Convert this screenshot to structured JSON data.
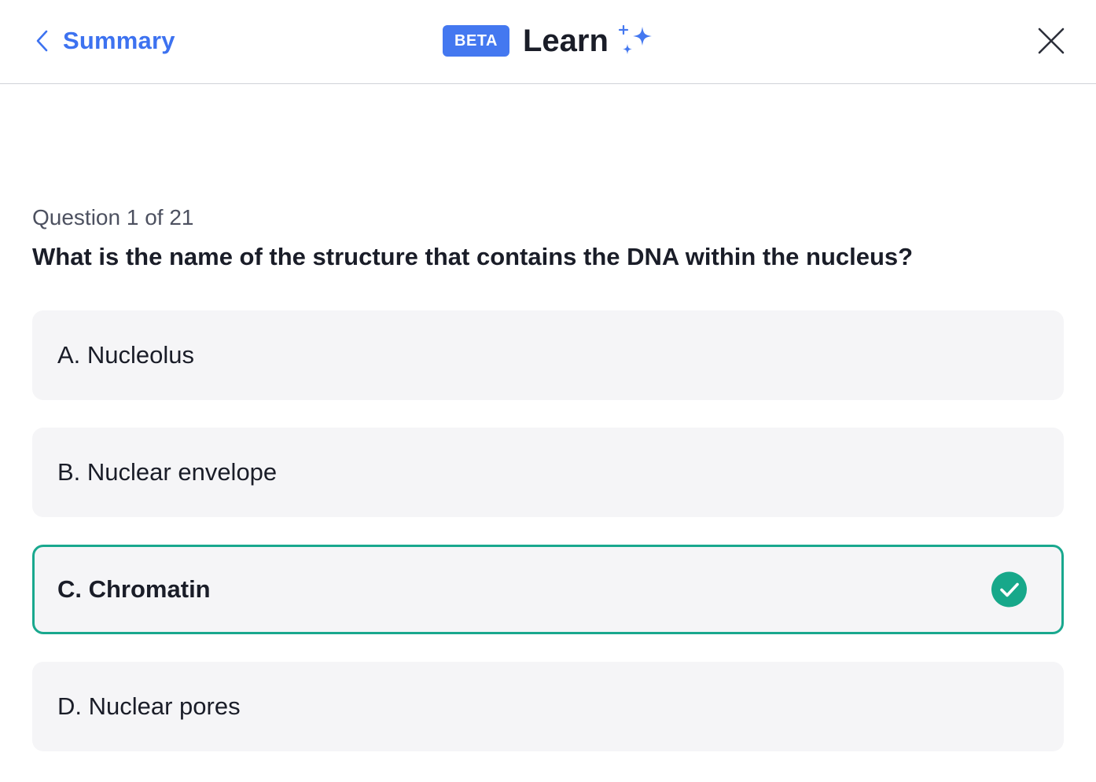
{
  "header": {
    "back_label": "Summary",
    "badge": "BETA",
    "title": "Learn",
    "accent_color": "#3d72f0"
  },
  "quiz": {
    "counter": "Question 1 of 21",
    "question": "What is the name of the structure that contains the DNA within the nucleus?",
    "options": [
      {
        "label": "A. Nucleolus",
        "state": "default"
      },
      {
        "label": "B. Nuclear envelope",
        "state": "default"
      },
      {
        "label": "C. Chromatin",
        "state": "correct"
      },
      {
        "label": "D. Nuclear pores",
        "state": "default"
      }
    ],
    "correct_color": "#19a88e"
  },
  "icons": {
    "back": "chevron-left-icon",
    "sparkle": "sparkle-icon",
    "close": "close-icon",
    "check": "check-circle-icon",
    "feedback": "thumbs-down-icon"
  }
}
